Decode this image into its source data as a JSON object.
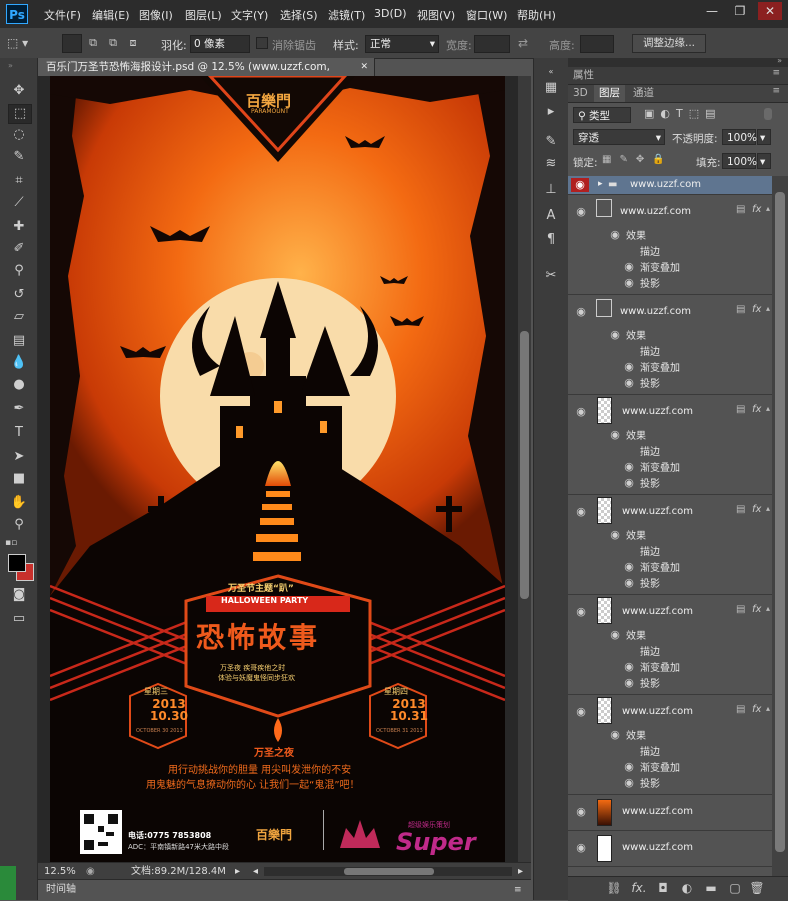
{
  "app": {
    "logo": "Ps"
  },
  "menu": [
    "文件(F)",
    "编辑(E)",
    "图像(I)",
    "图层(L)",
    "文字(Y)",
    "选择(S)",
    "滤镜(T)",
    "3D(D)",
    "视图(V)",
    "窗口(W)",
    "帮助(H)"
  ],
  "window_buttons": [
    "—",
    "❐",
    "✕"
  ],
  "options": {
    "feather_label": "羽化:",
    "feather_value": "0 像素",
    "antialias_label": "消除锯齿",
    "style_label": "样式:",
    "style_value": "正常",
    "width_label": "宽度:",
    "height_label": "高度:",
    "refine_edge": "调整边缘..."
  },
  "document": {
    "tab_title": "百乐门万圣节恐怖海报设计.psd @ 12.5% (www.uzzf.com, RGB/8*)",
    "close": "✕",
    "zoom": "12.5%",
    "doc_size": "文档:89.2M/128.4M",
    "timeline": "时间轴"
  },
  "poster": {
    "brand": "百樂門",
    "brand_sub": "PARAMOUNT",
    "theme_line": "万圣节主题“趴”",
    "party": "HALLOWEEN PARTY",
    "headline": "恐怖故事",
    "tagline1": "万圣夜 疾哥疾他之时",
    "tagline2": "体验与妖魔鬼怪同步狂欢",
    "date_left_day": "星期三",
    "date_left_num": "2013 10.30",
    "date_left_en": "OCTOBER 30 2013",
    "date_right_day": "星期四",
    "date_right_num": "2013 10.31",
    "date_right_en": "OCTOBER 31 2013",
    "night_title": "万圣之夜",
    "body1": "用行动挑战你的胆量 用尖叫发泄你的不安",
    "body2": "用鬼魅的气息撩动你的心 让我们一起“鬼混”吧！",
    "phone": "电话:0775 7853808",
    "address": "ADC：平南镇新路47米大路中段",
    "super_cn": "超级娱乐策划",
    "super_en": "Super"
  },
  "panel": {
    "tab_properties": "属性",
    "tab_3d": "3D",
    "tab_layers": "图层",
    "tab_channels": "通道",
    "filter_kind": "类型",
    "blend_mode": "穿透",
    "opacity_label": "不透明度:",
    "opacity_value": "100%",
    "lock_label": "锁定:",
    "fill_label": "填充:",
    "fill_value": "100%"
  },
  "layers": [
    {
      "name": "www.uzzf.com",
      "kind": "group",
      "selected": true
    },
    {
      "name": "www.uzzf.com",
      "kind": "text",
      "effects_label": "效果",
      "effects": [
        "描边",
        "渐变叠加",
        "投影"
      ]
    },
    {
      "name": "www.uzzf.com",
      "kind": "text",
      "effects_label": "效果",
      "effects": [
        "描边",
        "渐变叠加",
        "投影"
      ]
    },
    {
      "name": "www.uzzf.com",
      "kind": "pixel",
      "effects_label": "效果",
      "effects": [
        "描边",
        "渐变叠加",
        "投影"
      ]
    },
    {
      "name": "www.uzzf.com",
      "kind": "pixel",
      "effects_label": "效果",
      "effects": [
        "描边",
        "渐变叠加",
        "投影"
      ]
    },
    {
      "name": "www.uzzf.com",
      "kind": "pixel",
      "effects_label": "效果",
      "effects": [
        "描边",
        "渐变叠加",
        "投影"
      ]
    },
    {
      "name": "www.uzzf.com",
      "kind": "pixel",
      "effects_label": "效果",
      "effects": [
        "描边",
        "渐变叠加",
        "投影"
      ]
    },
    {
      "name": "www.uzzf.com",
      "kind": "image"
    },
    {
      "name": "www.uzzf.com",
      "kind": "white"
    }
  ]
}
